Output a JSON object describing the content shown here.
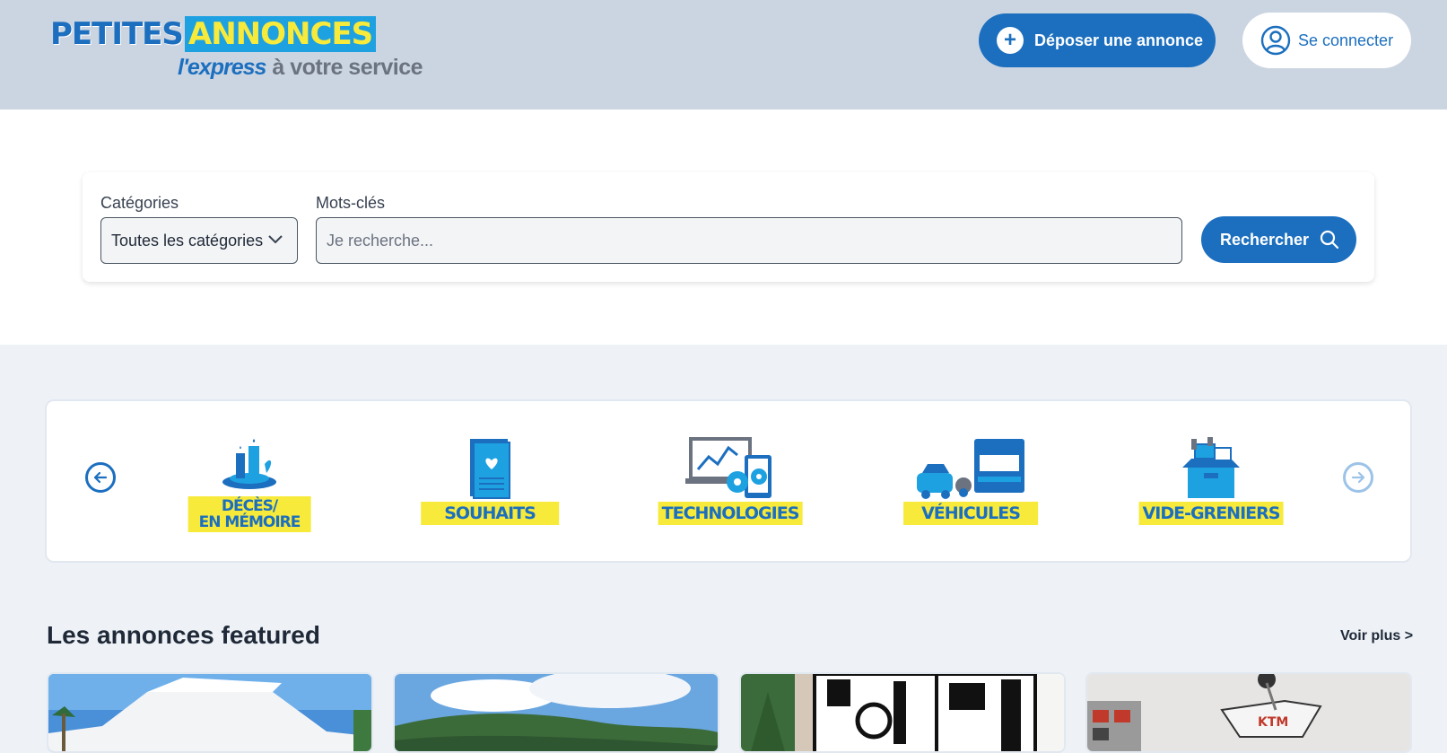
{
  "header": {
    "logo_top_left": "PETITES",
    "logo_top_right": "ANNONCES",
    "logo_express": "l'express",
    "logo_service": "à votre service",
    "post_button": "Déposer une annonce",
    "login_button": "Se connecter"
  },
  "search": {
    "category_label": "Catégories",
    "category_value": "Toutes les catégories",
    "keywords_label": "Mots-clés",
    "keywords_placeholder": "Je recherche...",
    "search_button": "Rechercher"
  },
  "categories": [
    {
      "label_line1": "DÉCÈS/",
      "label_line2": "EN MÉMOIRE",
      "icon": "candle-icon"
    },
    {
      "label_line1": "SOUHAITS",
      "icon": "card-heart-icon"
    },
    {
      "label_line1": "TECHNOLOGIES",
      "icon": "computer-gears-icon"
    },
    {
      "label_line1": "VÉHICULES",
      "icon": "vehicles-icon"
    },
    {
      "label_line1": "VIDE-GRENIERS",
      "icon": "box-icon"
    }
  ],
  "featured": {
    "title": "Les annonces featured",
    "see_more": "Voir plus >"
  },
  "colors": {
    "brand_blue": "#1c6fbf",
    "brand_yellow": "#f7ea3b",
    "header_bg": "#cbd5e1",
    "page_bg": "#eef2f7"
  }
}
